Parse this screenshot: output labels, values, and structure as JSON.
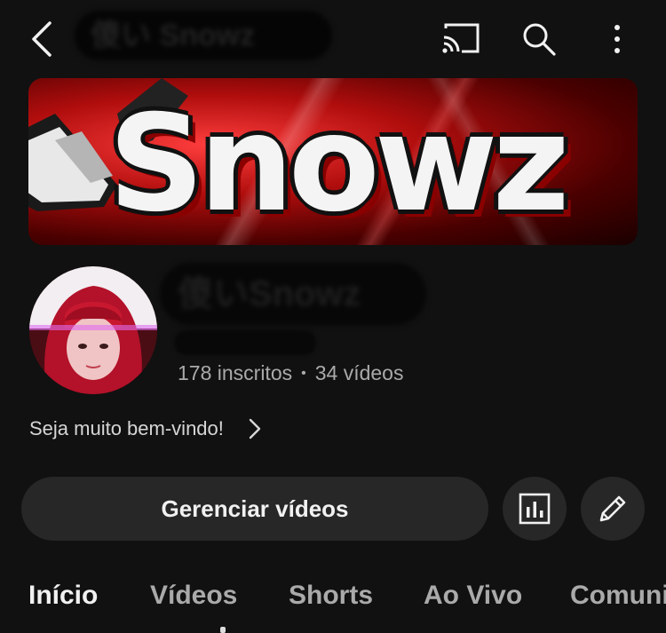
{
  "topbar": {
    "title": "傻い Snowz",
    "icons": [
      "back-arrow-icon",
      "cast-icon",
      "search-icon",
      "more-vert-icon"
    ]
  },
  "banner": {
    "logo_text": "Snowz"
  },
  "channel": {
    "name": "傻いSnowz",
    "subscribers": "178 inscritos",
    "separator": "•",
    "videos": "34 vídeos",
    "welcome": "Seja muito bem-vindo!"
  },
  "actions": {
    "manage_label": "Gerenciar vídeos",
    "analytics_icon": "analytics-icon",
    "edit_icon": "pencil-icon"
  },
  "tabs": [
    {
      "label": "Início",
      "active": true
    },
    {
      "label": "Vídeos",
      "active": false
    },
    {
      "label": "Shorts",
      "active": false
    },
    {
      "label": "Ao Vivo",
      "active": false
    },
    {
      "label": "Comunidade",
      "active": false
    }
  ],
  "colors": {
    "background": "#111111",
    "button": "#272727",
    "text_primary": "#f1f1f1",
    "text_secondary": "#aaaaaa",
    "banner_red": "#c41414"
  }
}
